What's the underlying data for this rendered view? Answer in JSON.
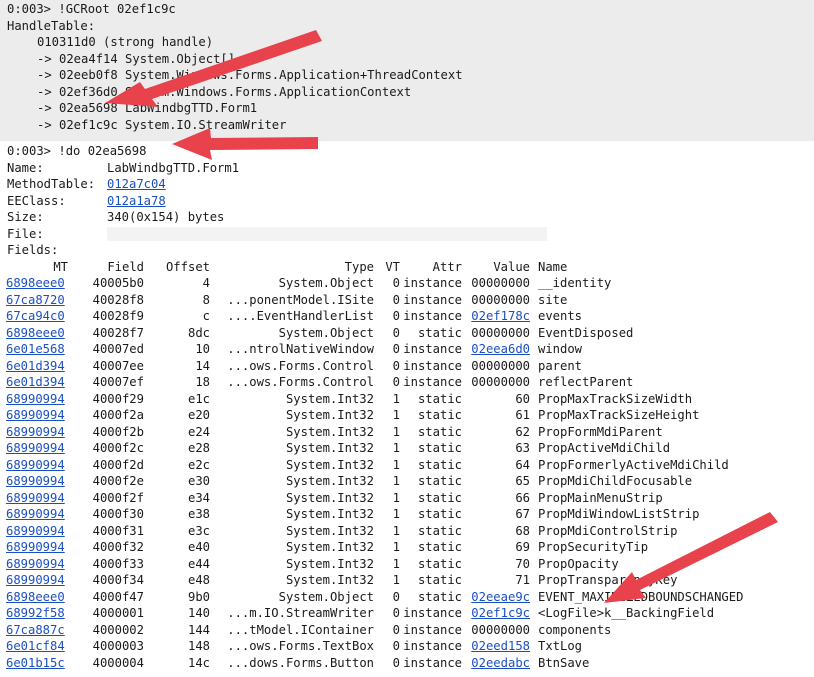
{
  "gcroot": {
    "command": "0:003> !GCRoot 02ef1c9c",
    "handle_table": "HandleTable:",
    "handle": "010311d0 (strong handle)",
    "chain": [
      "-> 02ea4f14 System.Object[]",
      "-> 02eeb0f8 System.Windows.Forms.Application+ThreadContext",
      "-> 02ef36d0 System.Windows.Forms.ApplicationContext",
      "-> 02ea5698 LabWindbgTTD.Form1",
      "-> 02ef1c9c System.IO.StreamWriter"
    ]
  },
  "dumpobj": {
    "command": "0:003> !do 02ea5698",
    "name_label": "Name:",
    "name_value": "LabWindbgTTD.Form1",
    "mt_label": "MethodTable:",
    "mt_value": "012a7c04",
    "eeclass_label": "EEClass:",
    "eeclass_value": "012a1a78",
    "size_label": "Size:",
    "size_value": "340(0x154) bytes",
    "file_label": "File:",
    "fields_label": "Fields:"
  },
  "fields": {
    "headers": [
      "MT",
      "Field",
      "Offset",
      "Type",
      "VT",
      "Attr",
      "Value",
      "Name"
    ],
    "rows": [
      {
        "mt": "6898eee0",
        "field": "40005b0",
        "offset": "4",
        "type": "System.Object",
        "vt": "0",
        "attr": "instance",
        "value": "00000000",
        "value_link": false,
        "name": "__identity"
      },
      {
        "mt": "67ca8720",
        "field": "40028f8",
        "offset": "8",
        "type": "...ponentModel.ISite",
        "vt": "0",
        "attr": "instance",
        "value": "00000000",
        "value_link": false,
        "name": "site"
      },
      {
        "mt": "67ca94c0",
        "field": "40028f9",
        "offset": "c",
        "type": "....EventHandlerList",
        "vt": "0",
        "attr": "instance",
        "value": "02ef178c",
        "value_link": true,
        "name": "events"
      },
      {
        "mt": "6898eee0",
        "field": "40028f7",
        "offset": "8dc",
        "type": "System.Object",
        "vt": "0",
        "attr": "static",
        "value": "00000000",
        "value_link": false,
        "name": "EventDisposed"
      },
      {
        "mt": "6e01e568",
        "field": "40007ed",
        "offset": "10",
        "type": "...ntrolNativeWindow",
        "vt": "0",
        "attr": "instance",
        "value": "02eea6d0",
        "value_link": true,
        "name": "window"
      },
      {
        "mt": "6e01d394",
        "field": "40007ee",
        "offset": "14",
        "type": "...ows.Forms.Control",
        "vt": "0",
        "attr": "instance",
        "value": "00000000",
        "value_link": false,
        "name": "parent"
      },
      {
        "mt": "6e01d394",
        "field": "40007ef",
        "offset": "18",
        "type": "...ows.Forms.Control",
        "vt": "0",
        "attr": "instance",
        "value": "00000000",
        "value_link": false,
        "name": "reflectParent"
      },
      {
        "mt": "68990994",
        "field": "4000f29",
        "offset": "e1c",
        "type": "System.Int32",
        "vt": "1",
        "attr": "static",
        "value": "60",
        "value_link": false,
        "name": "PropMaxTrackSizeWidth"
      },
      {
        "mt": "68990994",
        "field": "4000f2a",
        "offset": "e20",
        "type": "System.Int32",
        "vt": "1",
        "attr": "static",
        "value": "61",
        "value_link": false,
        "name": "PropMaxTrackSizeHeight"
      },
      {
        "mt": "68990994",
        "field": "4000f2b",
        "offset": "e24",
        "type": "System.Int32",
        "vt": "1",
        "attr": "static",
        "value": "62",
        "value_link": false,
        "name": "PropFormMdiParent"
      },
      {
        "mt": "68990994",
        "field": "4000f2c",
        "offset": "e28",
        "type": "System.Int32",
        "vt": "1",
        "attr": "static",
        "value": "63",
        "value_link": false,
        "name": "PropActiveMdiChild"
      },
      {
        "mt": "68990994",
        "field": "4000f2d",
        "offset": "e2c",
        "type": "System.Int32",
        "vt": "1",
        "attr": "static",
        "value": "64",
        "value_link": false,
        "name": "PropFormerlyActiveMdiChild"
      },
      {
        "mt": "68990994",
        "field": "4000f2e",
        "offset": "e30",
        "type": "System.Int32",
        "vt": "1",
        "attr": "static",
        "value": "65",
        "value_link": false,
        "name": "PropMdiChildFocusable"
      },
      {
        "mt": "68990994",
        "field": "4000f2f",
        "offset": "e34",
        "type": "System.Int32",
        "vt": "1",
        "attr": "static",
        "value": "66",
        "value_link": false,
        "name": "PropMainMenuStrip"
      },
      {
        "mt": "68990994",
        "field": "4000f30",
        "offset": "e38",
        "type": "System.Int32",
        "vt": "1",
        "attr": "static",
        "value": "67",
        "value_link": false,
        "name": "PropMdiWindowListStrip"
      },
      {
        "mt": "68990994",
        "field": "4000f31",
        "offset": "e3c",
        "type": "System.Int32",
        "vt": "1",
        "attr": "static",
        "value": "68",
        "value_link": false,
        "name": "PropMdiControlStrip"
      },
      {
        "mt": "68990994",
        "field": "4000f32",
        "offset": "e40",
        "type": "System.Int32",
        "vt": "1",
        "attr": "static",
        "value": "69",
        "value_link": false,
        "name": "PropSecurityTip"
      },
      {
        "mt": "68990994",
        "field": "4000f33",
        "offset": "e44",
        "type": "System.Int32",
        "vt": "1",
        "attr": "static",
        "value": "70",
        "value_link": false,
        "name": "PropOpacity"
      },
      {
        "mt": "68990994",
        "field": "4000f34",
        "offset": "e48",
        "type": "System.Int32",
        "vt": "1",
        "attr": "static",
        "value": "71",
        "value_link": false,
        "name": "PropTransparencyKey"
      },
      {
        "mt": "6898eee0",
        "field": "4000f47",
        "offset": "9b0",
        "type": "System.Object",
        "vt": "0",
        "attr": "static",
        "value": "02eeae9c",
        "value_link": true,
        "name": "EVENT_MAXIMIZEDBOUNDSCHANGED"
      },
      {
        "mt": "68992f58",
        "field": "4000001",
        "offset": "140",
        "type": "...m.IO.StreamWriter",
        "vt": "0",
        "attr": "instance",
        "value": "02ef1c9c",
        "value_link": true,
        "name": "<LogFile>k__BackingField"
      },
      {
        "mt": "67ca887c",
        "field": "4000002",
        "offset": "144",
        "type": "...tModel.IContainer",
        "vt": "0",
        "attr": "instance",
        "value": "00000000",
        "value_link": false,
        "name": "components"
      },
      {
        "mt": "6e01cf84",
        "field": "4000003",
        "offset": "148",
        "type": "...ows.Forms.TextBox",
        "vt": "0",
        "attr": "instance",
        "value": "02eed158",
        "value_link": true,
        "name": "TxtLog"
      },
      {
        "mt": "6e01b15c",
        "field": "4000004",
        "offset": "14c",
        "type": "...dows.Forms.Button",
        "vt": "0",
        "attr": "instance",
        "value": "02eedabc",
        "value_link": true,
        "name": "BtnSave"
      }
    ]
  },
  "colors": {
    "arrow": "#e8434d",
    "link": "#1a4fc4",
    "gcroot_bg": "#ececec"
  }
}
